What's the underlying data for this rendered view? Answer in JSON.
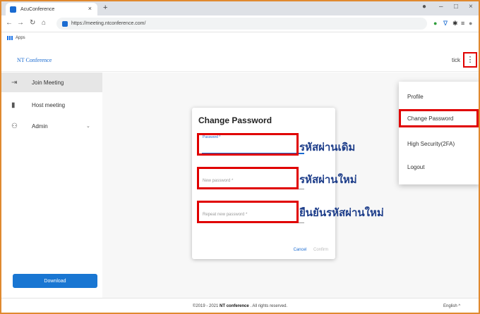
{
  "browser": {
    "tab_title": "AcuConference",
    "tab_close": "×",
    "new_tab": "+",
    "url": "https://meeting.ntconference.com/",
    "bookmark_apps": "Apps"
  },
  "app": {
    "brand": "NT Conference",
    "username": "tick",
    "kebab": "⋮"
  },
  "sidebar": {
    "items": [
      {
        "label": "Join Meeting",
        "icon": "⇥"
      },
      {
        "label": "Host meeting",
        "icon": "▮"
      },
      {
        "label": "Admin",
        "icon": "⚇"
      }
    ],
    "admin_chevron": "⌄",
    "download": "Download"
  },
  "dialog": {
    "title": "Change Password",
    "fields": [
      {
        "label": "Password *"
      },
      {
        "label": "New password *"
      },
      {
        "label": "Repeat new password *"
      }
    ],
    "cancel": "Cancel",
    "confirm": "Confirm"
  },
  "annotations": [
    "รหัสผ่านเดิม",
    "รหัสผ่านใหม่",
    "ยืนยันรหัสผ่านใหม่"
  ],
  "menu": {
    "items": [
      {
        "label": "Profile"
      },
      {
        "label": "Change Password"
      },
      {
        "label": "High Security(2FA)"
      },
      {
        "label": "Logout"
      }
    ]
  },
  "footer": {
    "copyright_prefix": "©2019 - 2021 ",
    "company": "NT conference",
    "copyright_suffix": " . All rights reserved.",
    "language": "English ^"
  },
  "colors": {
    "accent": "#1a6bd1",
    "highlight": "#e00000",
    "annotation": "#1e3e8a"
  }
}
